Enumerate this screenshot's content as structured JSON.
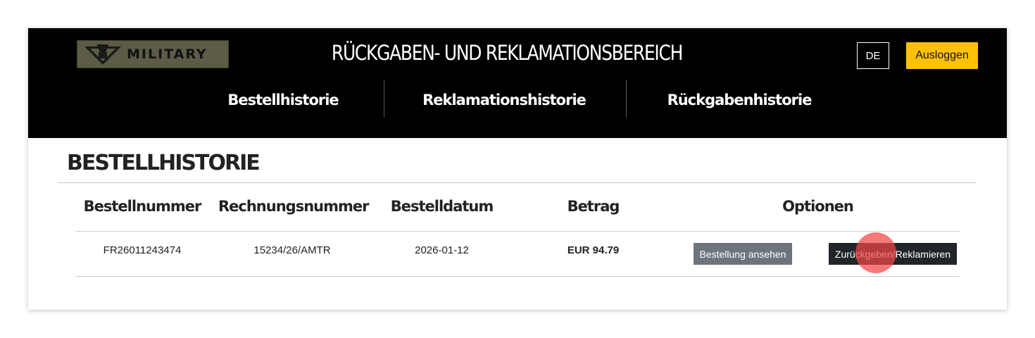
{
  "header": {
    "logo_text": "MILITARY",
    "title": "RÜCKGABEN- UND REKLAMATIONSBEREICH",
    "language": "DE",
    "logout_label": "Ausloggen",
    "nav": [
      {
        "label": "Bestellhistorie"
      },
      {
        "label": "Reklamationshistorie"
      },
      {
        "label": "Rückgabenhistorie"
      }
    ]
  },
  "main": {
    "section_title": "BESTELLHISTORIE",
    "table": {
      "columns": [
        "Bestellnummer",
        "Rechnungsnummer",
        "Bestelldatum",
        "Betrag",
        "Optionen"
      ],
      "rows": [
        {
          "order_number": "FR26011243474",
          "invoice_number": "15234/26/AMTR",
          "order_date": "2026-01-12",
          "amount": "EUR 94.79",
          "view_label": "Bestellung ansehen",
          "return_label": "Zurückgeben/Reklamieren"
        }
      ]
    }
  },
  "colors": {
    "header_bg": "#000000",
    "logout_bg": "#ffc107",
    "view_button_bg": "#6c757d",
    "return_button_bg": "#212529",
    "logo_bg": "#5c5c46"
  }
}
